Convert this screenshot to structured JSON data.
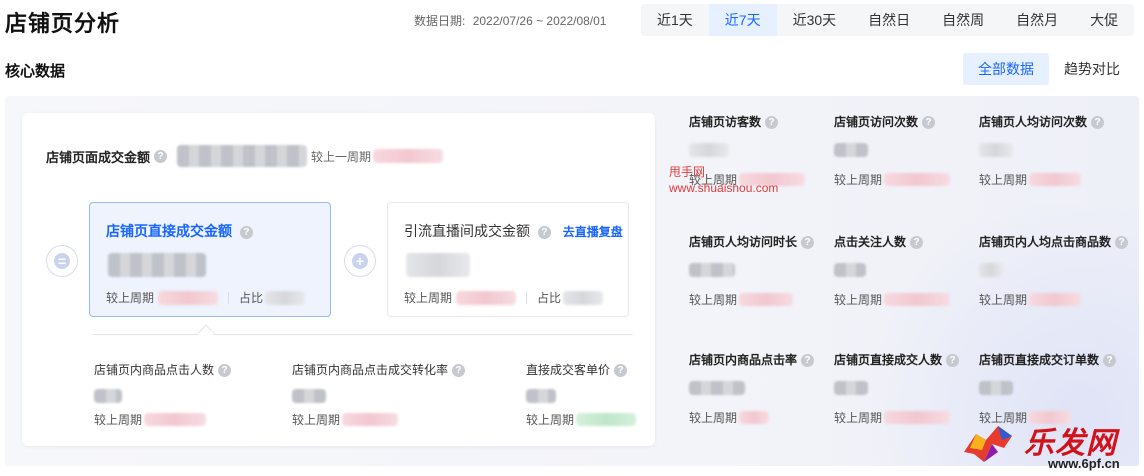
{
  "page_title": "店铺页分析",
  "date_range": {
    "label": "数据日期:",
    "value": "2022/07/26 ~ 2022/08/01"
  },
  "period_tabs": [
    {
      "label": "近1天",
      "active": false
    },
    {
      "label": "近7天",
      "active": true
    },
    {
      "label": "近30天",
      "active": false
    },
    {
      "label": "自然日",
      "active": false
    },
    {
      "label": "自然周",
      "active": false
    },
    {
      "label": "自然月",
      "active": false
    },
    {
      "label": "大促",
      "active": false
    }
  ],
  "section_title": "核心数据",
  "view_tabs": [
    {
      "label": "全部数据",
      "active": true
    },
    {
      "label": "趋势对比",
      "active": false
    }
  ],
  "main": {
    "total_label": "店铺页面成交金额",
    "total_compare": "较上一周期",
    "direct": {
      "title": "店铺页直接成交金额",
      "compare": "较上周期",
      "ratio": "占比"
    },
    "live": {
      "title": "引流直播间成交金额",
      "link": "去直播复盘",
      "compare": "较上周期",
      "ratio": "占比"
    },
    "bottom": [
      {
        "name": "店铺页内商品点击人数",
        "compare": "较上周期"
      },
      {
        "name": "店铺页内商品点击成交转化率",
        "compare": "较上周期"
      },
      {
        "name": "直接成交客单价",
        "compare": "较上周期"
      }
    ]
  },
  "side_metrics": [
    {
      "name": "店铺页访客数",
      "compare": "较上周期"
    },
    {
      "name": "店铺页访问次数",
      "compare": "较上周期"
    },
    {
      "name": "店铺页人均访问次数",
      "compare": "较上周期"
    },
    {
      "name": "店铺页人均访问时长",
      "compare": "较上周期"
    },
    {
      "name": "点击关注人数",
      "compare": "较上周期"
    },
    {
      "name": "店铺页内人均点击商品数",
      "compare": "较上周期"
    },
    {
      "name": "店铺页内商品点击率",
      "compare": "较上周期"
    },
    {
      "name": "店铺页直接成交人数",
      "compare": "较上周期"
    },
    {
      "name": "店铺页直接成交订单数",
      "compare": "较上周期"
    }
  ],
  "watermark": {
    "line1": "甩手网",
    "line2": "www.shuaishou.com"
  },
  "logo": {
    "cn": "乐发网",
    "en": "www.6pf.cn"
  }
}
